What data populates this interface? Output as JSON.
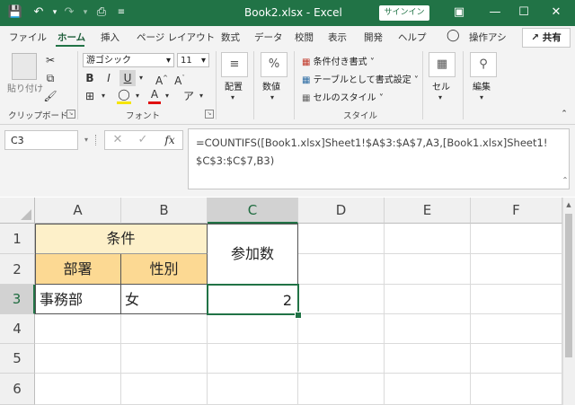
{
  "titlebar": {
    "title": "Book2.xlsx  -  Excel",
    "signin": "サインイン"
  },
  "tabs": [
    "ファイル",
    "ホーム",
    "挿入",
    "ページ レイアウト",
    "数式",
    "データ",
    "校閲",
    "表示",
    "開発",
    "ヘルプ"
  ],
  "search_label": "操作アシ",
  "share_label": "共有",
  "ribbon": {
    "paste_label": "貼り付け",
    "clipboard_group": "クリップボード",
    "font_name": "游ゴシック",
    "font_size": "11",
    "font_group": "フォント",
    "alignment_label": "配置",
    "number_label": "数値",
    "style_items": [
      "条件付き書式 ˅",
      "テーブルとして書式設定 ˅",
      "セルのスタイル ˅"
    ],
    "style_group": "スタイル",
    "cells_label": "セル",
    "editing_label": "編集"
  },
  "namebox": "C3",
  "formula": "=COUNTIFS([Book1.xlsx]Sheet1!$A$3:$A$7,A3,[Book1.xlsx]Sheet1!\n$C$3:$C$7,B3)",
  "columns": [
    "A",
    "B",
    "C",
    "D",
    "E",
    "F"
  ],
  "rows": [
    "1",
    "2",
    "3",
    "4",
    "5",
    "6"
  ],
  "cells": {
    "A1": "条件",
    "A2": "部署",
    "B2": "性別",
    "C1": "参加数",
    "A3": "事務部",
    "B3": "女",
    "C3": "2"
  },
  "colors": {
    "excel_green": "#217346",
    "title_fill": "#fdf0c9",
    "header_fill": "#fcd993"
  }
}
